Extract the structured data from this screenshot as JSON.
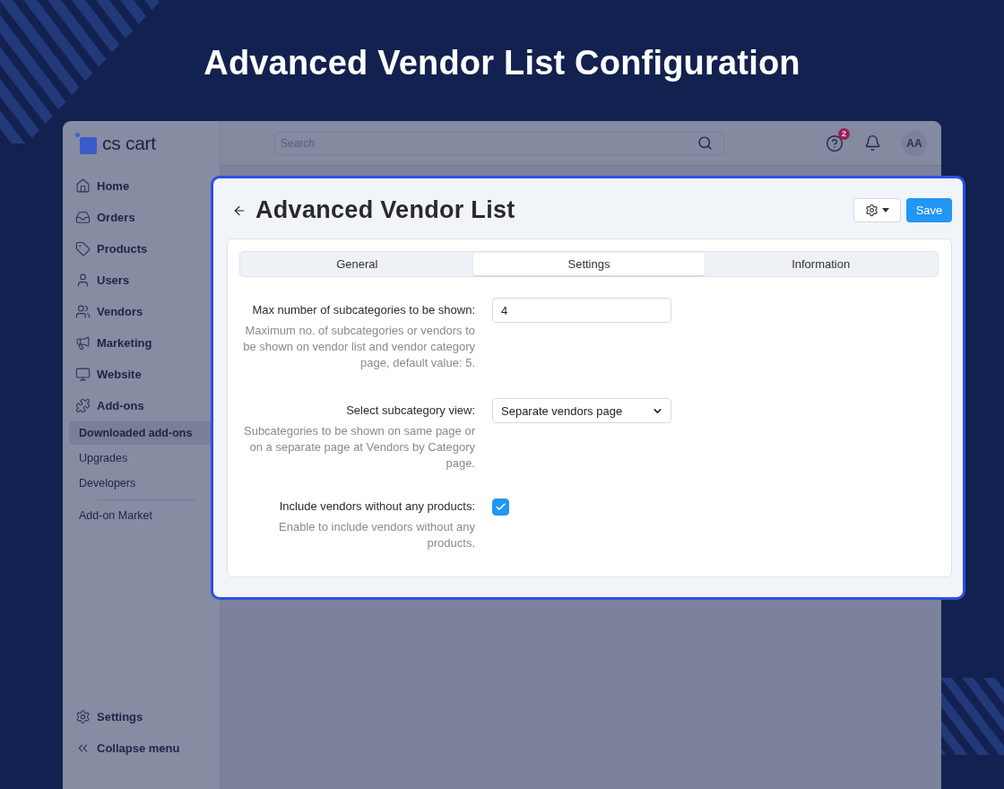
{
  "heading": "Advanced Vendor List Configuration",
  "sidebar": {
    "logo": "cs cart",
    "items": [
      {
        "label": "Home",
        "selected": false
      },
      {
        "label": "Orders",
        "selected": false
      },
      {
        "label": "Products",
        "selected": false
      },
      {
        "label": "Users",
        "selected": false
      },
      {
        "label": "Vendors",
        "selected": false
      },
      {
        "label": "Marketing",
        "selected": false
      },
      {
        "label": "Website",
        "selected": false
      },
      {
        "label": "Add-ons",
        "selected": false,
        "children": [
          {
            "label": "Downloaded add-ons",
            "selected": true,
            "separated": false
          },
          {
            "label": "Upgrades",
            "selected": false,
            "separated": false
          },
          {
            "label": "Developers",
            "selected": false,
            "separated": false
          },
          {
            "label": "Add-on Market",
            "selected": false,
            "separated": true
          }
        ]
      }
    ],
    "footer": [
      {
        "label": "Settings"
      },
      {
        "label": "Collapse menu"
      }
    ]
  },
  "top_bar": {
    "search": {
      "placeholder": "Search"
    },
    "help_badge": "2",
    "avatar": "AA"
  },
  "modal": {
    "title": "Advanced Vendor List",
    "save_button": "Save",
    "tabs": [
      {
        "label": "General",
        "selected": false
      },
      {
        "label": "Settings",
        "selected": true
      },
      {
        "label": "Information",
        "selected": false
      }
    ],
    "settings": [
      {
        "kind": "input",
        "label": "Max number of subcategories to be shown:",
        "description": "Maximum no. of subcategories or vendors to be shown on vendor list and vendor category page, default value: 5.",
        "value": "4"
      },
      {
        "kind": "select",
        "label": "Select subcategory view:",
        "description": "Subcategories to be shown on same page or on a separate page at Vendors by Category page.",
        "value": "Separate vendors page"
      },
      {
        "kind": "checkbox",
        "label": "Include vendors without any products:",
        "description": "Enable to include vendors without any products.",
        "checked": true
      }
    ]
  }
}
